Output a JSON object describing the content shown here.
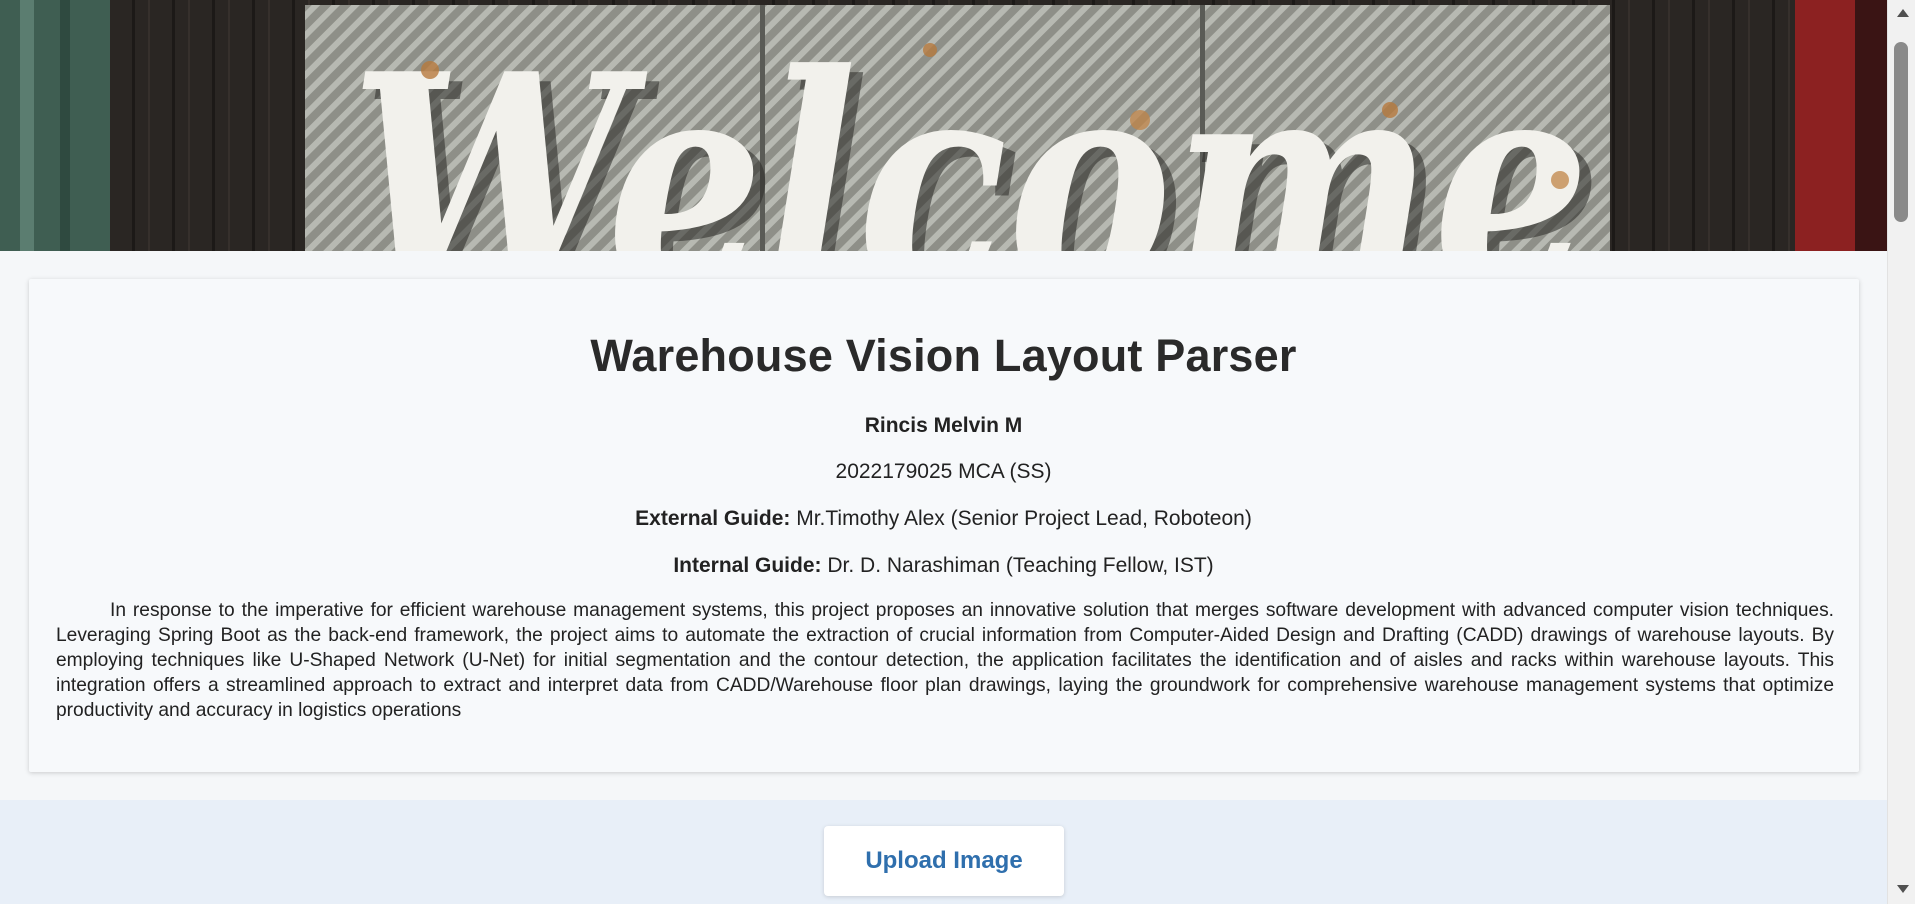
{
  "banner": {
    "text": "Welcome"
  },
  "project": {
    "title": "Warehouse Vision Layout Parser",
    "author": "Rincis Melvin M",
    "id_line": "2022179025 MCA (SS)",
    "external_guide_label": "External Guide:",
    "external_guide": "Mr.Timothy Alex (Senior Project Lead, Roboteon)",
    "internal_guide_label": "Internal Guide:",
    "internal_guide": "Dr. D. Narashiman (Teaching Fellow, IST)",
    "abstract": "In response to the imperative for efficient warehouse management systems, this project proposes an innovative solution that merges software development with advanced computer vision techniques. Leveraging Spring Boot as the back-end framework, the project aims to automate the extraction of crucial information from Computer-Aided Design and Drafting (CADD) drawings of warehouse layouts. By employing techniques like U-Shaped Network (U-Net) for initial segmentation and the contour detection, the application facilitates the identification and of aisles and racks within warehouse layouts. This integration offers a streamlined approach to extract and interpret data from CADD/Warehouse floor plan drawings, laying the groundwork for comprehensive warehouse management systems that optimize productivity and accuracy in logistics operations"
  },
  "upload": {
    "button_label": "Upload Image"
  },
  "colors": {
    "accent": "#2f6fad",
    "upload_bg": "#e8eff8",
    "card_bg": "#f7f9fb"
  }
}
